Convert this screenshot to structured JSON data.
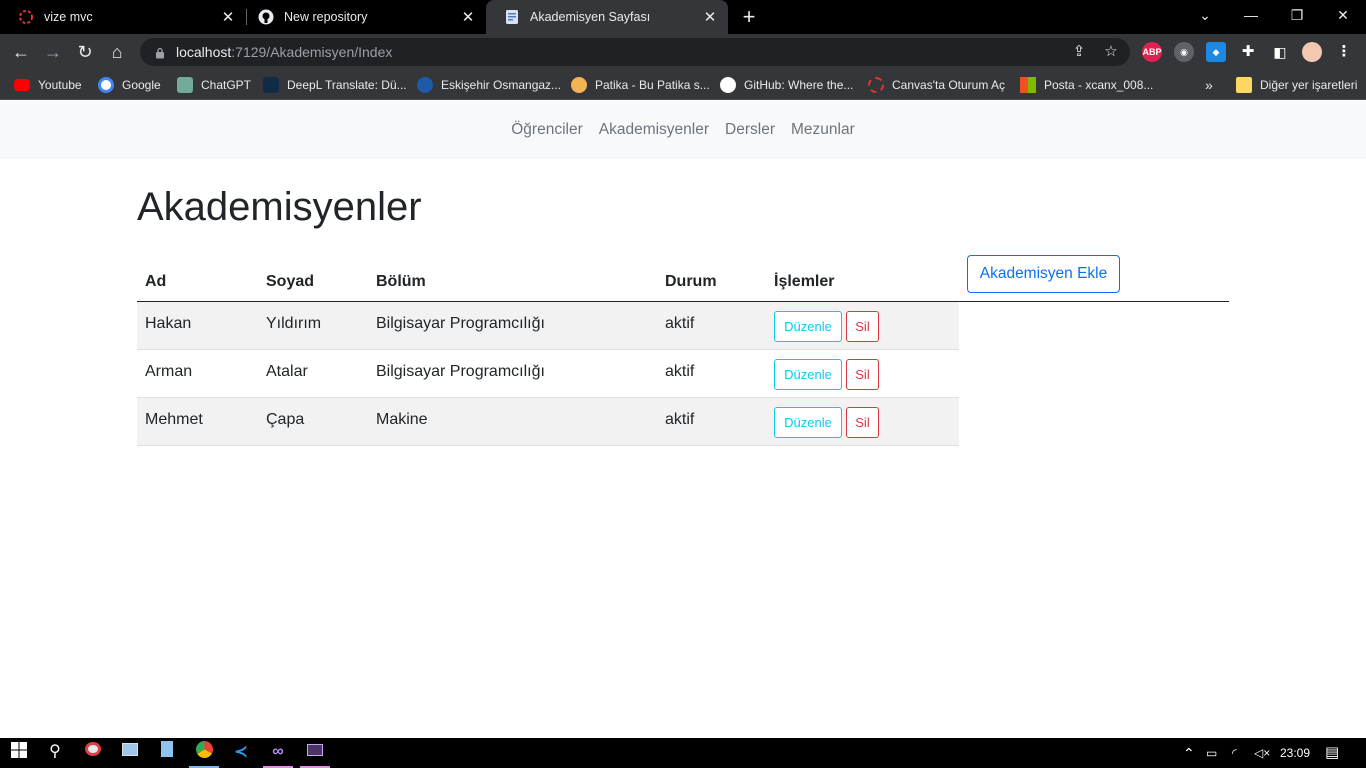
{
  "browser": {
    "tabs": [
      {
        "title": "vize mvc",
        "icon": "loader-icon"
      },
      {
        "title": "New repository",
        "icon": "github-icon"
      },
      {
        "title": "Akademisyen Sayfası",
        "icon": "page-icon"
      }
    ],
    "url_host": "localhost",
    "url_path": ":7129/Akademisyen/Index",
    "extensions": {
      "abp_label": "ABP"
    },
    "bookmarks": [
      {
        "label": "Youtube",
        "color": "#ff0000"
      },
      {
        "label": "Google",
        "color": "#ffffff"
      },
      {
        "label": "ChatGPT",
        "color": "#74aa9c"
      },
      {
        "label": "DeepL Translate: Dü...",
        "color": "#0f2b46"
      },
      {
        "label": "Eskişehir Osmangaz...",
        "color": "#1e5aa8"
      },
      {
        "label": "Patika - Bu Patika s...",
        "color": "#f5b454"
      },
      {
        "label": "GitHub: Where the...",
        "color": "#ffffff"
      },
      {
        "label": "Canvas'ta Oturum Aç",
        "color": "#e13535"
      },
      {
        "label": "Posta - xcanx_008...",
        "color": "#f25022"
      }
    ],
    "bookmarks_more": "»",
    "other_bookmarks": "Diğer yer işaretleri"
  },
  "nav": {
    "items": [
      "Öğrenciler",
      "Akademisyenler",
      "Dersler",
      "Mezunlar"
    ]
  },
  "page": {
    "title": "Akademisyenler",
    "add_button": "Akademisyen Ekle"
  },
  "table": {
    "headers": [
      "Ad",
      "Soyad",
      "Bölüm",
      "Durum",
      "İşlemler"
    ],
    "rows": [
      {
        "ad": "Hakan",
        "soyad": "Yıldırım",
        "bolum": "Bilgisayar Programcılığı",
        "durum": "aktif"
      },
      {
        "ad": "Arman",
        "soyad": "Atalar",
        "bolum": "Bilgisayar Programcılığı",
        "durum": "aktif"
      },
      {
        "ad": "Mehmet",
        "soyad": "Çapa",
        "bolum": "Makine",
        "durum": "aktif"
      }
    ],
    "edit_label": "Düzenle",
    "delete_label": "Sil"
  },
  "taskbar": {
    "time": "23:09"
  },
  "colors": {
    "primary": "#0d6efd",
    "info": "#0dcaf0",
    "danger": "#dc3545",
    "navbar_bg": "#f8f9fa"
  }
}
